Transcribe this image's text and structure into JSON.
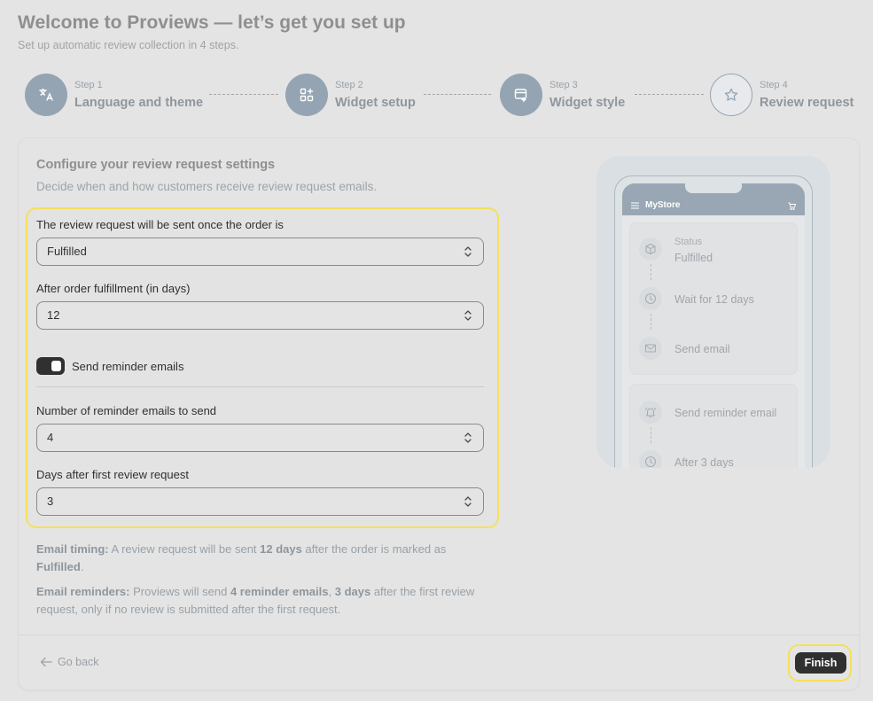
{
  "header": {
    "title": "Welcome to Proviews — let’s get you set up",
    "subtitle": "Set up automatic review collection in 4 steps."
  },
  "steps": [
    {
      "num": "Step 1",
      "label": "Language and theme",
      "icon": "translate-icon",
      "state": "done"
    },
    {
      "num": "Step 2",
      "label": "Widget setup",
      "icon": "widget-grid-icon",
      "state": "done"
    },
    {
      "num": "Step 3",
      "label": "Widget style",
      "icon": "widget-style-icon",
      "state": "done"
    },
    {
      "num": "Step 4",
      "label": "Review request",
      "icon": "star-icon",
      "state": "current"
    }
  ],
  "card": {
    "title": "Configure your review request settings",
    "description": "Decide when and how customers receive review request emails."
  },
  "form": {
    "order_status_label": "The review request will be sent once the order is",
    "order_status_value": "Fulfilled",
    "days_label": "After order fulfillment (in days)",
    "days_value": "12",
    "reminder_toggle_label": "Send reminder emails",
    "reminder_toggle_on": true,
    "reminder_count_label": "Number of reminder emails to send",
    "reminder_count_value": "4",
    "reminder_days_label": "Days after first review request",
    "reminder_days_value": "3"
  },
  "summary": {
    "timing_label": "Email timing:",
    "timing_text_1": " A review request will be sent ",
    "timing_days": "12 days",
    "timing_text_2": " after the order is marked as ",
    "timing_status": "Fulfilled",
    "timing_text_3": ".",
    "reminders_label": "Email reminders:",
    "reminders_text_1": " Proviews will send ",
    "reminders_count": "4 reminder emails",
    "reminders_text_2": ", ",
    "reminders_days": "3 days",
    "reminders_text_3": " after the first review request, only if no review is submitted after the first request."
  },
  "preview": {
    "store_name": "MyStore",
    "status_label": "Status",
    "status_value": "Fulfilled",
    "wait_text": "Wait for 12 days",
    "send_email_text": "Send email",
    "reminder_text": "Send reminder email",
    "after_text": "After 3 days"
  },
  "footer": {
    "go_back_label": "Go back",
    "finish_label": "Finish"
  },
  "colors": {
    "accent_highlight": "#f5e05a",
    "step_circle": "#94a4b2",
    "primary_button": "#303030"
  }
}
